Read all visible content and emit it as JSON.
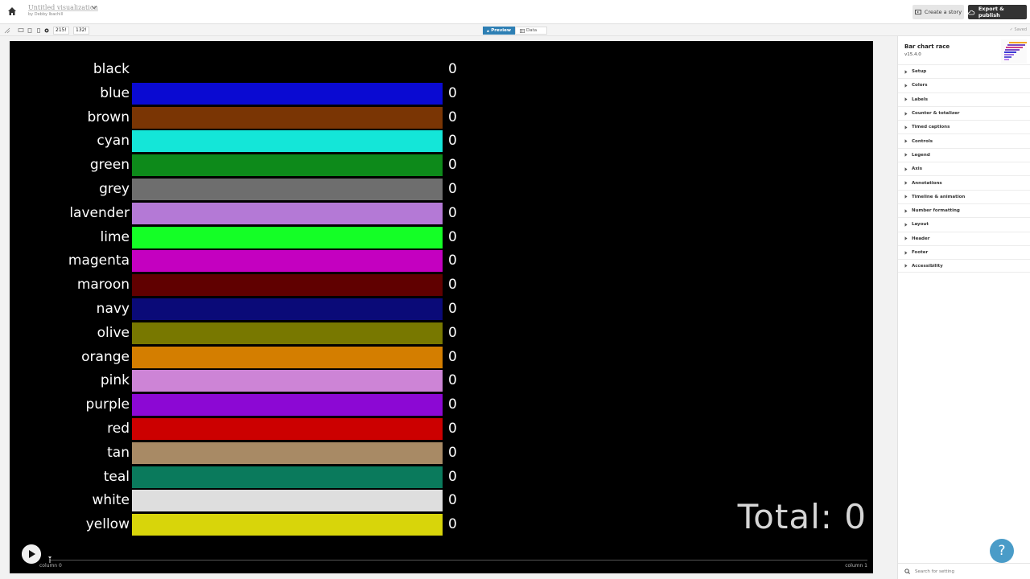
{
  "header": {
    "doc_title": "Untitled visualization",
    "doc_author": "by Debby Ibachill",
    "create_story_label": "Create a story",
    "export_label": "Export & publish"
  },
  "toolbar": {
    "width_value": "215!",
    "height_value": "132!",
    "tabs": [
      {
        "label": "Preview",
        "active": true
      },
      {
        "label": "Data",
        "active": false
      }
    ],
    "saved_label": "Saved"
  },
  "chart_data": {
    "type": "bar",
    "categories": [
      "black",
      "blue",
      "brown",
      "cyan",
      "green",
      "grey",
      "lavender",
      "lime",
      "magenta",
      "maroon",
      "navy",
      "olive",
      "orange",
      "pink",
      "purple",
      "red",
      "tan",
      "teal",
      "white",
      "yellow"
    ],
    "values": [
      0,
      0,
      0,
      0,
      0,
      0,
      0,
      0,
      0,
      0,
      0,
      0,
      0,
      0,
      0,
      0,
      0,
      0,
      0,
      0
    ],
    "bar_colors": [
      "#000000",
      "#0a0ad2",
      "#7a3504",
      "#14e6d8",
      "#0d8a1a",
      "#6e6e6e",
      "#b479d6",
      "#14ff26",
      "#c400c0",
      "#600000",
      "#0a0a78",
      "#787800",
      "#d47e00",
      "#cd84d6",
      "#8c08d4",
      "#cc0000",
      "#a88a65",
      "#0a7a5c",
      "#dedede",
      "#d8d50a"
    ],
    "total_label": "Total:",
    "total_value": "0",
    "timeline_start": "column 0",
    "timeline_end": "column 1"
  },
  "panel": {
    "title": "Bar chart race",
    "version": "v15.4.0",
    "sections": [
      "Setup",
      "Colors",
      "Labels",
      "Counter & totalizer",
      "Timed captions",
      "Controls",
      "Legend",
      "Axis",
      "Annotations",
      "Timeline & animation",
      "Number formatting",
      "Layout",
      "Header",
      "Footer",
      "Accessibility"
    ],
    "search_placeholder": "Search for setting"
  },
  "help_label": "?"
}
